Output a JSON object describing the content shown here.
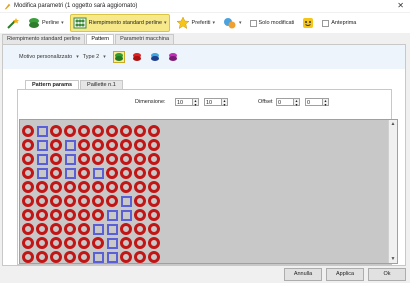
{
  "window": {
    "title": "Modifica parametri (1 oggetto sarà aggiornato)"
  },
  "toolbar": {
    "perline_label": "Perline",
    "riempimento_label": "Riempimento standard perline",
    "preferiti_label": "Preferiti",
    "solo_modificati_label": "Solo modificati",
    "anteprima_label": "Anteprima"
  },
  "tabs": [
    "Riempimento standard perline",
    "Pattern",
    "Parametri macchina"
  ],
  "motivo": {
    "label": "Motivo personalizzato",
    "type_label": "Type 2"
  },
  "subtabs": [
    "Pattern params",
    "Paillette n.1"
  ],
  "dimensione": {
    "label": "Dimensione:",
    "w": "10",
    "h": "10"
  },
  "offset": {
    "label": "Offset",
    "x": "0",
    "y": "0"
  },
  "buttons": {
    "annulla": "Annulla",
    "applica": "Applica",
    "ok": "Ok"
  },
  "colors": {
    "ring": "#c21616",
    "square": "#5a5fd6",
    "accent": "#f7e98a"
  },
  "pattern": [
    "OSOOOOOOOO",
    "OSOSOOOOOO",
    "OSOSOOOOOO",
    "OSOSOSOOOO",
    "OOOOOOOOOO",
    "OOOOOOOSOO",
    "OOOOOOSSOO",
    "OOOOOSSOOO",
    "OOOOOOSOOO",
    "OOOOOSSOOO"
  ]
}
